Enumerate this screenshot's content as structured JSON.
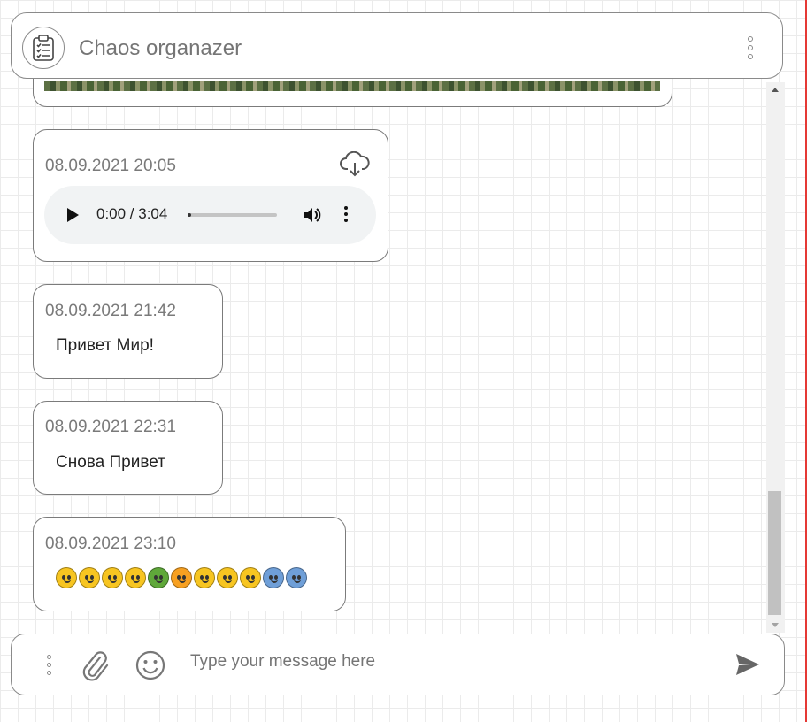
{
  "header": {
    "title": "Chaos organazer",
    "logo_icon": "clipboard-list-icon",
    "menu_icon": "vertical-dots-icon"
  },
  "messages": [
    {
      "type": "image",
      "content": "photo-of-plants"
    },
    {
      "type": "audio",
      "timestamp": "08.09.2021 20:05",
      "download_icon": "cloud-download-icon",
      "player": {
        "time": "0:00 / 3:04",
        "progress": 0.0
      }
    },
    {
      "type": "text",
      "timestamp": "08.09.2021 21:42",
      "text": "Привет Мир!"
    },
    {
      "type": "text",
      "timestamp": "08.09.2021 22:31",
      "text": "Снова Привет"
    },
    {
      "type": "emoji",
      "timestamp": "08.09.2021 23:10",
      "emojis": [
        {
          "name": "dizzy-face",
          "color": "#f7c521"
        },
        {
          "name": "confused-face",
          "color": "#f7c521"
        },
        {
          "name": "rolling-eyes",
          "color": "#f7c521"
        },
        {
          "name": "loudly-crying-face",
          "color": "#f7c521"
        },
        {
          "name": "nauseated-face",
          "color": "#5fa83a"
        },
        {
          "name": "angry-face",
          "color": "#f7a021"
        },
        {
          "name": "astonished-face",
          "color": "#f7c521"
        },
        {
          "name": "loudly-crying-face",
          "color": "#f7c521"
        },
        {
          "name": "smiling-face-with-halo",
          "color": "#f7c521"
        },
        {
          "name": "fearful-face",
          "color": "#6f9fd8"
        },
        {
          "name": "fearful-face",
          "color": "#6f9fd8"
        }
      ]
    }
  ],
  "input_bar": {
    "placeholder": "Type your message here",
    "value": "",
    "menu_icon": "vertical-dots-icon",
    "attach_icon": "paperclip-icon",
    "emoji_icon": "smiley-icon",
    "send_icon": "send-icon"
  },
  "colors": {
    "border": "#7b7b7b",
    "accent_edge": "#e53935",
    "text_muted": "#757575"
  }
}
